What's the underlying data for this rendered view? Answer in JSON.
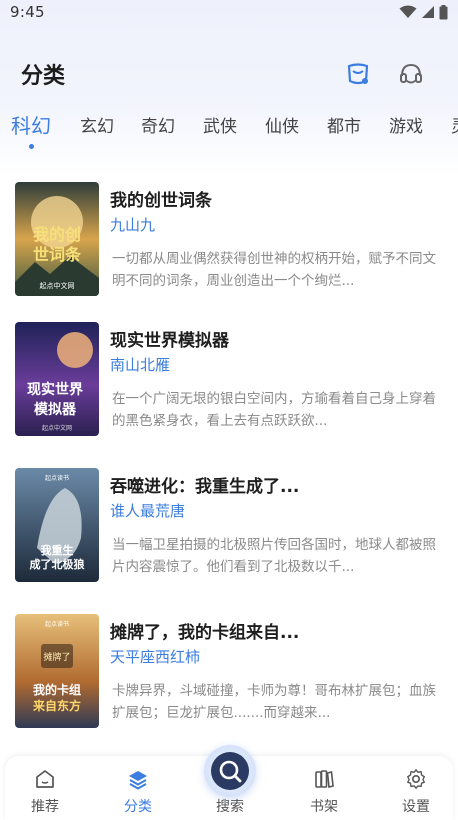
{
  "status": {
    "time": "9:45"
  },
  "header": {
    "title": "分类",
    "icons": [
      "bag-icon",
      "headset-icon"
    ]
  },
  "tabs": [
    {
      "label": "科幻",
      "active": true
    },
    {
      "label": "玄幻"
    },
    {
      "label": "奇幻"
    },
    {
      "label": "武侠"
    },
    {
      "label": "仙侠"
    },
    {
      "label": "都市"
    },
    {
      "label": "游戏"
    },
    {
      "label": "灵"
    }
  ],
  "books": [
    {
      "title": "我的创世词条",
      "author": "九山九",
      "desc": "一切都从周业偶然获得创世神的权柄开始，赋予不同文明不同的词条，周业创造出一个个绚烂...",
      "cover_text": "我的创世词条",
      "cover_sub": "起点中文网",
      "cover_colors": [
        "#d8a44c",
        "#3c5a42"
      ]
    },
    {
      "title": "现实世界模拟器",
      "author": "南山北雁",
      "desc": "在一个广阔无垠的银白空间内，方瑜看着自己身上穿着的黑色紧身衣，看上去有点跃跃欲...",
      "cover_text": "现实世界模拟器",
      "cover_sub": "起点中文网",
      "cover_colors": [
        "#2c2f6a",
        "#8a4aa8"
      ]
    },
    {
      "title": "吞噬进化：我重生成了...",
      "author": "谁人最荒唐",
      "desc": "当一幅卫星拍摄的北极照片传回各国时，地球人都被照片内容震惊了。他们看到了北极数以千...",
      "cover_text": "吞噬进化 我重生成了北极狼",
      "cover_sub": "起点读书",
      "cover_colors": [
        "#4a6b8c",
        "#1d2a3a"
      ]
    },
    {
      "title": "摊牌了，我的卡组来自...",
      "author": "天平座西红柿",
      "desc": "卡牌异界，斗域碰撞，卡师为尊！哥布林扩展包；血族扩展包；巨龙扩展包.......而穿越来...",
      "cover_text": "摊牌了 我的卡组来自东方",
      "cover_sub": "起点读书",
      "cover_colors": [
        "#c98a3a",
        "#3a4a6a"
      ]
    }
  ],
  "nav": {
    "items": [
      {
        "label": "推荐",
        "icon": "home-icon"
      },
      {
        "label": "分类",
        "icon": "layers-icon",
        "active": true
      },
      {
        "label": "搜索",
        "icon": "search-icon"
      },
      {
        "label": "书架",
        "icon": "bookshelf-icon"
      },
      {
        "label": "设置",
        "icon": "gear-icon"
      }
    ]
  }
}
